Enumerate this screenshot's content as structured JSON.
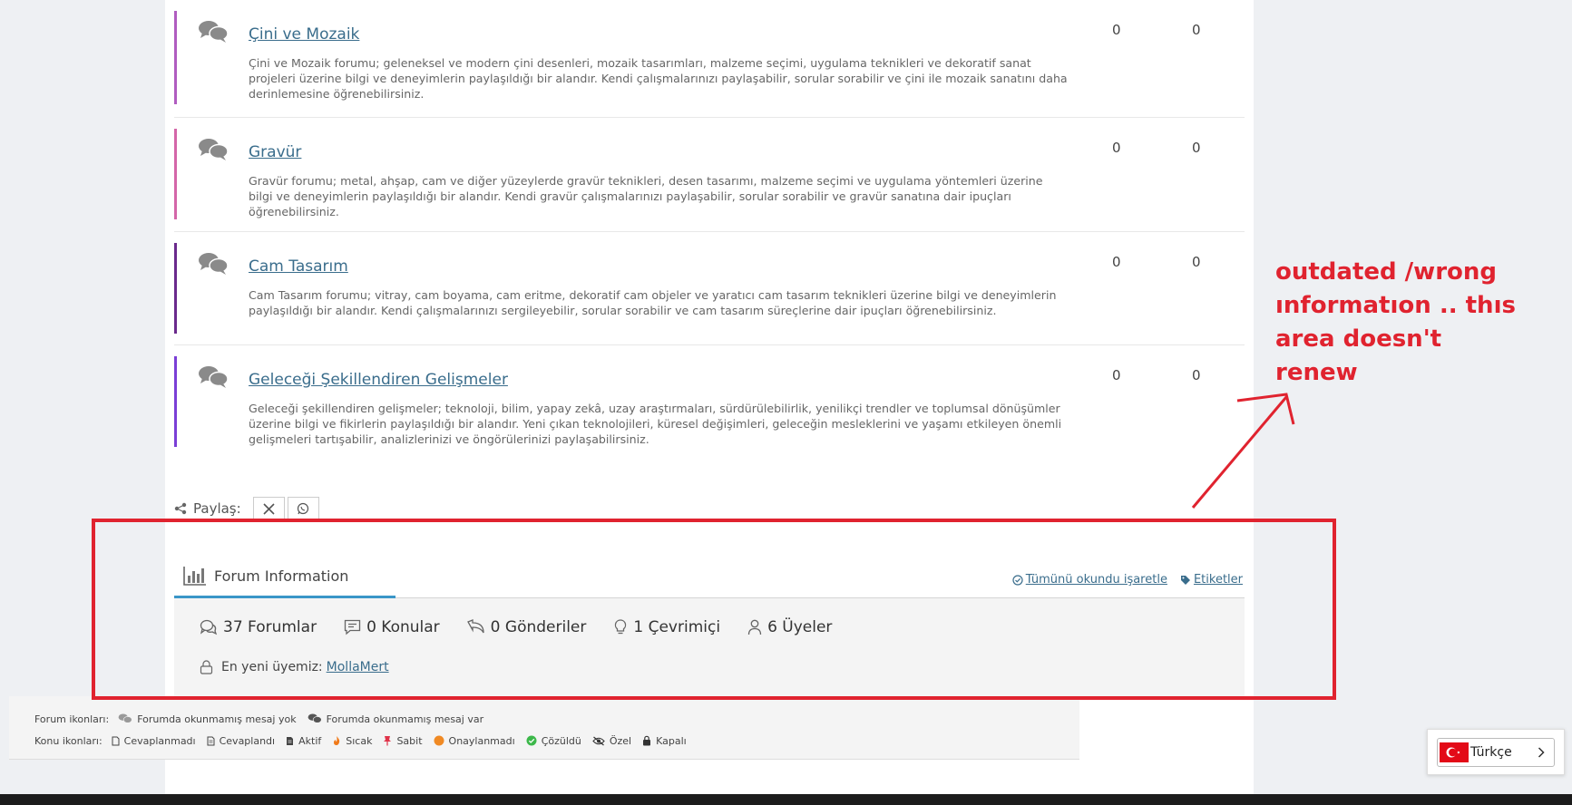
{
  "forums": [
    {
      "title": "Çini ve Mozaik",
      "desc": "Çini ve Mozaik forumu; geleneksel ve modern çini desenleri, mozaik tasarımları, malzeme seçimi, uygulama teknikleri ve dekoratif sanat projeleri üzerine bilgi ve deneyimlerin paylaşıldığı bir alandır. Kendi çalışmalarınızı paylaşabilir, sorular sorabilir ve çini ile mozaik sanatını daha derinlemesine öğrenebilirsiniz.",
      "topics": "0",
      "posts": "0",
      "color": "#b05cc0"
    },
    {
      "title": "Gravür",
      "desc": "Gravür forumu; metal, ahşap, cam ve diğer yüzeylerde gravür teknikleri, desen tasarımı, malzeme seçimi ve uygulama yöntemleri üzerine bilgi ve deneyimlerin paylaşıldığı bir alandır. Kendi gravür çalışmalarınızı paylaşabilir, sorular sorabilir ve gravür sanatına dair ipuçları öğrenebilirsiniz.",
      "topics": "0",
      "posts": "0",
      "color": "#d466a8"
    },
    {
      "title": "Cam Tasarım",
      "desc": "Cam Tasarım forumu; vitray, cam boyama, cam eritme, dekoratif cam objeler ve yaratıcı cam tasarım teknikleri üzerine bilgi ve deneyimlerin paylaşıldığı bir alandır. Kendi çalışmalarınızı sergileyebilir, sorular sorabilir ve cam tasarım süreçlerine dair ipuçları öğrenebilirsiniz.",
      "topics": "0",
      "posts": "0",
      "color": "#6a2a8c"
    },
    {
      "title": "Geleceği Şekillendiren Gelişmeler",
      "desc": "Geleceği şekillendiren gelişmeler; teknoloji, bilim, yapay zekâ, uzay araştırmaları, sürdürülebilirlik, yenilikçi trendler ve toplumsal dönüşümler üzerine bilgi ve fikirlerin paylaşıldığı bir alandır. Yeni çıkan teknolojileri, küresel değişimleri, geleceğin mesleklerini ve yaşamı etkileyen önemli gelişmeleri tartışabilir, analizlerinizi ve öngörülerinizi paylaşabilirsiniz.",
      "topics": "0",
      "posts": "0",
      "color": "#7a3ed6"
    }
  ],
  "share": {
    "label": "Paylaş:"
  },
  "forum_info": {
    "title": "Forum Information",
    "mark_all_read": "Tümünü okundu işaretle",
    "tags": "Etiketler",
    "stats": {
      "forums": "37 Forumlar",
      "topics": "0 Konular",
      "posts": "0 Gönderiler",
      "online": "1 Çevrimiçi",
      "members": "6 Üyeler"
    },
    "newest_label": "En yeni üyemiz:",
    "newest_member": "MollaMert"
  },
  "legend": {
    "forum_icons_label": "Forum ikonları:",
    "forum_no_unread": "Forumda okunmamış mesaj yok",
    "forum_unread": "Forumda okunmamış mesaj var",
    "topic_icons_label": "Konu ikonları:",
    "topic_items": [
      "Cevaplanmadı",
      "Cevaplandı",
      "Aktif",
      "Sıcak",
      "Sabit",
      "Onaylanmadı",
      "Çözüldü",
      "Özel",
      "Kapalı"
    ]
  },
  "annotation": {
    "line1": "outdated /wrong",
    "line2": "ınformatıon .. thıs",
    "line3": "area doesn't",
    "line4": "renew",
    "color": "#e0232f"
  },
  "language": {
    "label": "Türkçe"
  }
}
